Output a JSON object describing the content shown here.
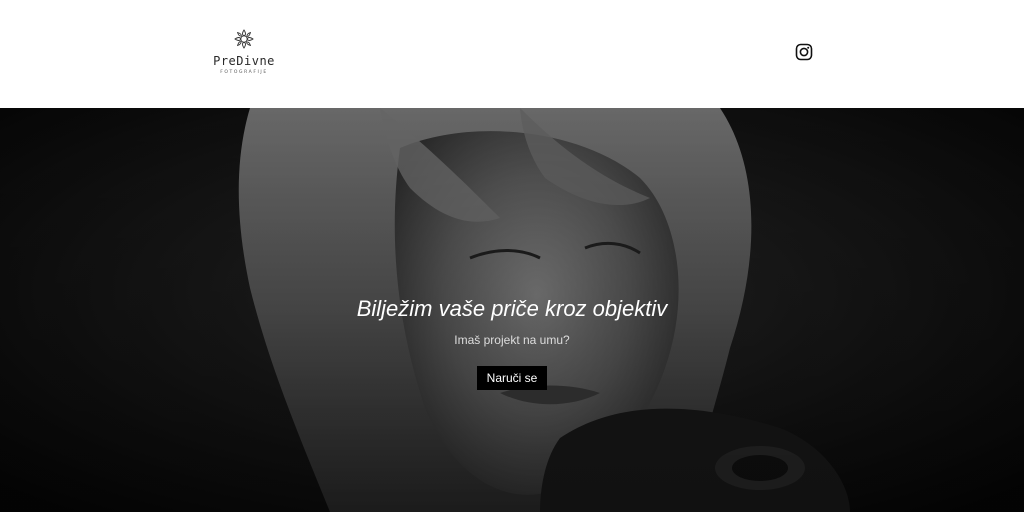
{
  "header": {
    "brand": {
      "name": "PreDivne",
      "subtitle": "FOTOGRAFIJE",
      "icon": "flower-logo-icon"
    },
    "social": {
      "icon": "instagram-icon"
    }
  },
  "hero": {
    "title": "Bilježim vaše priče kroz objektiv",
    "subtitle": "Imaš projekt na umu?",
    "cta_label": "Naruči se",
    "background": "black-and-white portrait photo of a woman holding a camera"
  },
  "colors": {
    "header_bg": "#ffffff",
    "hero_text": "#ffffff",
    "cta_bg": "#000000",
    "cta_text": "#ffffff"
  }
}
